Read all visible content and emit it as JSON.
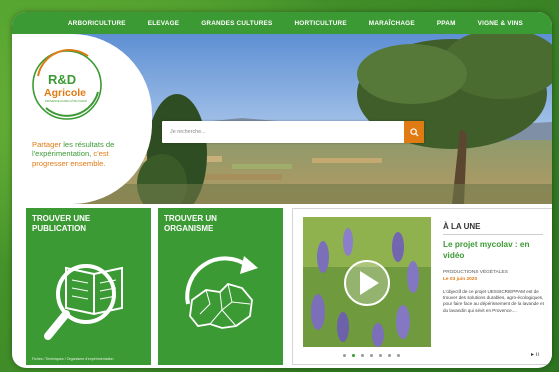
{
  "nav": {
    "items": [
      "ARBORICULTURE",
      "ELEVAGE",
      "GRANDES CULTURES",
      "HORTICULTURE",
      "MARAÎCHAGE",
      "PPAM",
      "VIGNE & VINS"
    ]
  },
  "logo": {
    "title": "R&D",
    "subtitle": "Agricole",
    "small": "PROVENCE-ALPES-CÔTE D'AZUR"
  },
  "tagline": {
    "part1": "Partager ",
    "part2": "les résultats de l'expérimentation,",
    "part3": " c'est progresser ensemble."
  },
  "search": {
    "placeholder": "Je recherche..."
  },
  "tiles": [
    {
      "title": "TROUVER UNE PUBLICATION",
      "footer": "Fiches / Techniques / Organisme d'expérimentation"
    },
    {
      "title": "TROUVER UN ORGANISME",
      "footer": ""
    }
  ],
  "une": {
    "heading": "À LA UNE",
    "title": "Le projet mycolav : en vidéo",
    "category": "PRODUCTIONS VÉGÉTALES",
    "date": "Le 03 juin 2020",
    "text": "L'objectif de ce projet UESSICRIEPPAM est de trouver des solutions durables, agro-écologiques, pour faire face au dépérissement de la lavande et du lavandin qui sévit en Provence....",
    "dots": 7,
    "active_dot": 1,
    "controls": "▸ ıı"
  },
  "colors": {
    "green": "#3c9a35",
    "orange": "#e07b14"
  }
}
